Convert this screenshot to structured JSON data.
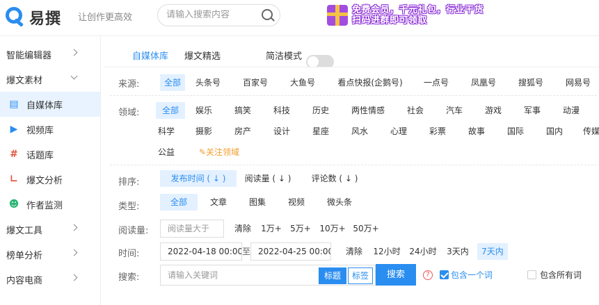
{
  "header": {
    "logo_text": "易撰",
    "slogan": "让创作更高效",
    "search_placeholder": "请输入搜索内容",
    "banner_line1": "免费会员，千元礼包，行业干货",
    "banner_line2": "扫码进群即可领取"
  },
  "sidebar": {
    "items": [
      {
        "label": "智能编辑器"
      },
      {
        "label": "爆文素材"
      },
      {
        "label": "自媒体库",
        "icon": "document-icon"
      },
      {
        "label": "视频库",
        "icon": "video-icon"
      },
      {
        "label": "话题库",
        "icon": "hashtag-icon"
      },
      {
        "label": "爆文分析",
        "icon": "chart-icon"
      },
      {
        "label": "作者监测",
        "icon": "user-add-icon"
      },
      {
        "label": "爆文工具"
      },
      {
        "label": "榜单分析"
      },
      {
        "label": "内容电商"
      }
    ]
  },
  "tabs": {
    "media_library": "自媒体库",
    "hot_picks": "爆文精选",
    "simple_mode": "简洁模式"
  },
  "filters": {
    "source": {
      "label": "来源:",
      "options": [
        "全部",
        "头条号",
        "百家号",
        "大鱼号",
        "看点快报(企鹅号)",
        "一点号",
        "凤凰号",
        "搜狐号",
        "网易号"
      ]
    },
    "domain": {
      "label": "领域:",
      "row1": [
        "全部",
        "娱乐",
        "搞笑",
        "科技",
        "历史",
        "两性情感",
        "社会",
        "汽车",
        "游戏",
        "军事",
        "动漫"
      ],
      "row2": [
        "科学",
        "摄影",
        "房产",
        "设计",
        "星座",
        "风水",
        "心理",
        "彩票",
        "故事",
        "国际",
        "国内",
        "传媒"
      ],
      "row3": [
        "公益"
      ],
      "follow": "关注领域"
    },
    "sort": {
      "label": "排序:",
      "options": [
        "发布时间 ( ↓ )",
        "阅读量 ( ↓ )",
        "评论数 ( ↓ )"
      ]
    },
    "type": {
      "label": "类型:",
      "options": [
        "全部",
        "文章",
        "图集",
        "视频",
        "微头条"
      ]
    },
    "reads": {
      "label": "阅读量:",
      "placeholder": "阅读量大于",
      "options": [
        "清除",
        "1万+",
        "5万+",
        "10万+",
        "50万+"
      ]
    },
    "time": {
      "label": "时间:",
      "start": "2022-04-18 00:00",
      "to": "至",
      "end": "2022-04-25 00:00",
      "options": [
        "清除",
        "12小时",
        "24小时",
        "3天内",
        "7天内"
      ]
    },
    "search": {
      "label": "搜索:",
      "placeholder": "请输入关键词",
      "title_btn": "标题",
      "tag_btn": "标签",
      "submit": "搜索",
      "help": "?",
      "include_one": "包含一个词",
      "include_all": "包含所有词"
    }
  },
  "colors": {
    "accent": "#2a8df0",
    "selected_bg": "#e3f0ff",
    "banner_purple": "#8a2bd6"
  }
}
